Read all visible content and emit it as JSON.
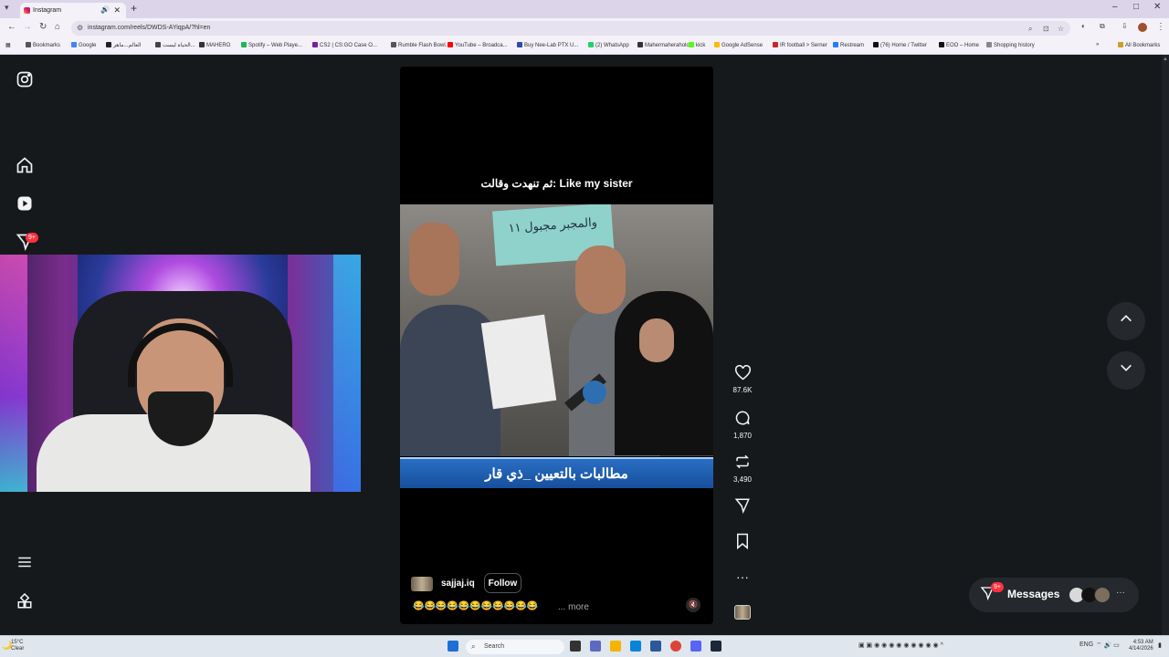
{
  "browser": {
    "tab_title": "Instagram",
    "new_tab_label": "+",
    "url": "instagram.com/reels/DWDS-AYiqpA/?hl=en",
    "window_controls": [
      "–",
      "□",
      "✕"
    ],
    "bookmarks": [
      {
        "label": "Bookmarks",
        "color": "#555555"
      },
      {
        "label": "Google",
        "color": "#4285f4"
      },
      {
        "label": "العالم...ماهر",
        "color": "#222222"
      },
      {
        "label": "الحياة ليست...",
        "color": "#444444"
      },
      {
        "label": "MAHERO",
        "color": "#333333"
      },
      {
        "label": "Spotify – Web Playe...",
        "color": "#1db954"
      },
      {
        "label": "CS2 | CS:GO Case O...",
        "color": "#7b1fa2"
      },
      {
        "label": "Rumble Flash Bowl...",
        "color": "#555555"
      },
      {
        "label": "YouTube – Broadca...",
        "color": "#ff0000"
      },
      {
        "label": "Buy Nee-Lab PTX U...",
        "color": "#2a4fa3"
      },
      {
        "label": "(2) WhatsApp",
        "color": "#25d366"
      },
      {
        "label": "Mahermaheraholc",
        "color": "#333333"
      },
      {
        "label": "kick",
        "color": "#53fc18"
      },
      {
        "label": "Google AdSense",
        "color": "#fbbc05"
      },
      {
        "label": "IR football > Serner",
        "color": "#c62828"
      },
      {
        "label": "Restream",
        "color": "#2979ff"
      },
      {
        "label": "(76) Home / Twitter",
        "color": "#111111"
      },
      {
        "label": "EOO – Home",
        "color": "#111111"
      },
      {
        "label": "Shopping history",
        "color": "#888888"
      }
    ],
    "all_bookmarks": "All Bookmarks"
  },
  "sidebar": {
    "icons": [
      "instagram-logo-icon",
      "home-icon",
      "reels-icon",
      "messages-icon",
      "menu-icon",
      "more-apps-icon"
    ],
    "messages_badge": "9+"
  },
  "reel": {
    "overlay_caption": "ثم تنهدت وقالت: Like my sister",
    "sign_text": "والمجبر مجبول ١١",
    "news_banner": "مطالبات بالتعيين _ذي قار",
    "author": "sajjaj.iq",
    "follow_label": "Follow",
    "description": "😂😂😂😂😂😂😂😂😂😂😂",
    "more_label": "... more",
    "volume_icon": "🔇"
  },
  "actions": {
    "likes": "87.6K",
    "comments": "1,870",
    "reposts": "3,490"
  },
  "nav": {
    "prev_icon": "chevron-up-icon",
    "next_icon": "chevron-down-icon"
  },
  "messages_pill": {
    "label": "Messages",
    "badge": "9+",
    "more": "···"
  },
  "taskbar": {
    "temp": "15°C",
    "condition": "Clear",
    "search_placeholder": "Search",
    "lang": "ENG",
    "time": "4:53 AM",
    "date": "4/14/2026"
  },
  "colors": {
    "page_bg": "#16191c",
    "badge_red": "#ff3040",
    "banner_blue": "#1d5db0"
  }
}
